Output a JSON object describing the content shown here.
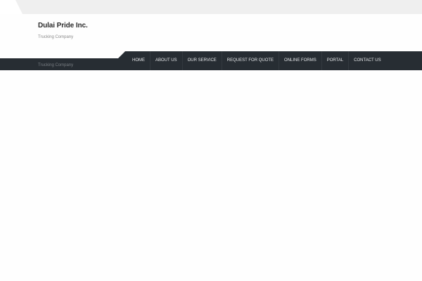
{
  "site": {
    "title": "Dulai Pride Inc.",
    "tagline": "Trucking Company",
    "nav_tagline": "Trucking Company"
  },
  "nav": {
    "items": [
      {
        "label": "HOME"
      },
      {
        "label": "ABOUT US"
      },
      {
        "label": "OUR SERVICE"
      },
      {
        "label": "REQUEST FOR QUOTE"
      },
      {
        "label": "ONLINE FORMS"
      },
      {
        "label": "PORTAL"
      },
      {
        "label": "CONTACT US"
      }
    ]
  },
  "colors": {
    "navbar": "#272d33",
    "top_strip": "#efefef",
    "background": "#fefefe"
  }
}
